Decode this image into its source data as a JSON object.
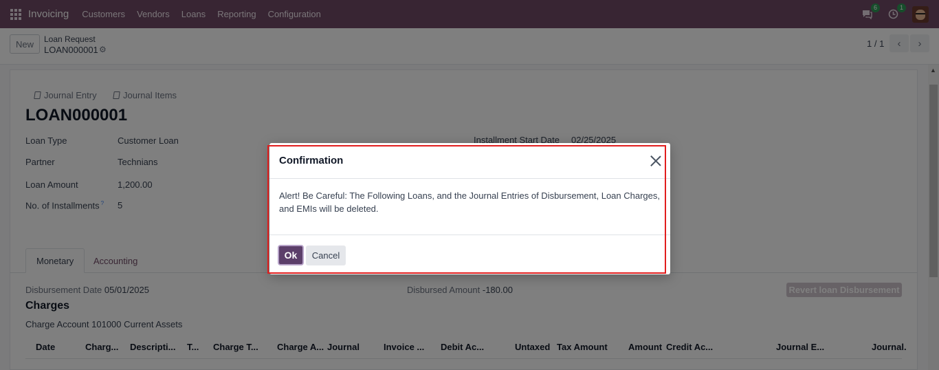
{
  "nav": {
    "brand": "Invoicing",
    "menu": [
      "Customers",
      "Vendors",
      "Loans",
      "Reporting",
      "Configuration"
    ],
    "messages_count": "6",
    "activities_count": "1"
  },
  "control": {
    "new_label": "New",
    "breadcrumb_parent": "Loan Request",
    "breadcrumb_record": "LOAN000001",
    "pager": "1 / 1"
  },
  "form": {
    "smart_buttons": [
      "Journal Entry",
      "Journal Items"
    ],
    "title": "LOAN000001",
    "fields": [
      {
        "label": "Loan Type",
        "value": "Customer Loan"
      },
      {
        "label": "Partner",
        "value": "Technians"
      },
      {
        "label": "Loan Amount",
        "value": "1,200.00"
      },
      {
        "label": "No. of Installments",
        "value": "5",
        "help": "?"
      }
    ],
    "installment_start_label": "Installment Start Date",
    "installment_start_value": "02/25/2025",
    "tabs": [
      "Monetary",
      "Accounting"
    ],
    "disbursement_date_label": "Disbursement Date",
    "disbursement_date_value": "05/01/2025",
    "disbursed_amount_label": "Disbursed Amount",
    "disbursed_amount_value": "-180.00",
    "revert_label": "Revert loan Disbursement",
    "charges_title": "Charges",
    "charge_account_label": "Charge Account",
    "charge_account_value": "101000 Current Assets",
    "columns": [
      "Date",
      "Charg...",
      "Descripti...",
      "T...",
      "Charge T...",
      "Charge A...",
      "Journal",
      "Invoice ...",
      "Debit Ac...",
      "Untaxed",
      "Tax Amount",
      "Amount",
      "Credit Ac...",
      "Journal E...",
      "Journal."
    ]
  },
  "modal": {
    "title": "Confirmation",
    "body": "Alert! Be Careful: The Following Loans, and the Journal Entries of Disbursement, Loan Charges, and EMIs will be deleted.",
    "ok_label": "Ok",
    "cancel_label": "Cancel"
  },
  "colors": {
    "navbar": "#714b67",
    "primary_button": "#5c3f6a",
    "highlight_border": "#e11d1d"
  }
}
